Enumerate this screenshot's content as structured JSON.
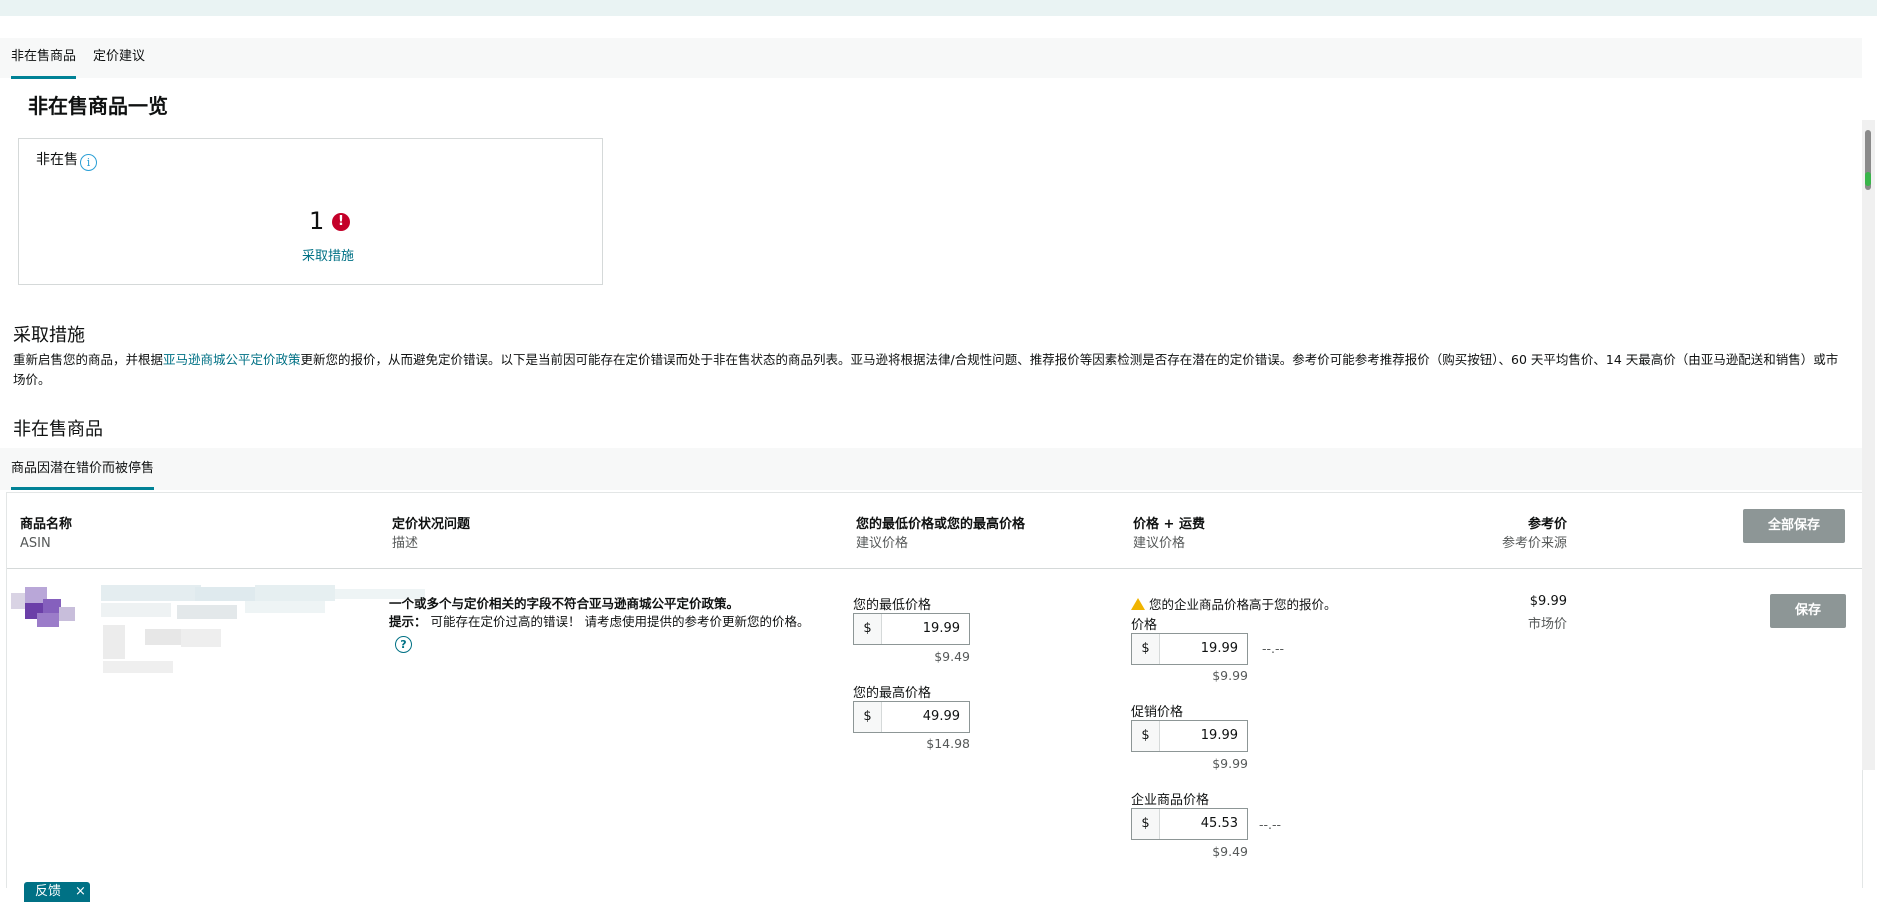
{
  "tabs": [
    {
      "label": "非在售商品",
      "active": true
    },
    {
      "label": "定价建议",
      "active": false
    }
  ],
  "page_title": "非在售商品一览",
  "summary": {
    "label": "非在售",
    "count": "1",
    "link": "采取措施"
  },
  "action": {
    "title": "采取措施",
    "desc_before": "重新启售您的商品，并根据",
    "desc_link": "亚马逊商城公平定价政策",
    "desc_after": "更新您的报价，从而避免定价错误。以下是当前因可能存在定价错误而处于非在售状态的商品列表。亚马逊将根据法律/合规性问题、推荐报价等因素检测是否存在潜在的定价错误。参考价可能参考推荐报价（购买按钮）、60 天平均售价、14 天最高价（由亚马逊配送和销售）或市场价。"
  },
  "inactive_section_title": "非在售商品",
  "subtab": {
    "label": "商品因潜在错价而被停售"
  },
  "table": {
    "headers": {
      "name": "商品名称",
      "name_sub": "ASIN",
      "issue": "定价状况问题",
      "issue_sub": "描述",
      "minmax": "您的最低价格或您的最高价格",
      "minmax_sub": "建议价格",
      "price": "价格 + 运费",
      "price_sub": "建议价格",
      "ref": "参考价",
      "ref_sub": "参考价来源"
    },
    "save_all": "全部保存",
    "row": {
      "issue_title": "一个或多个与定价相关的字段不符合亚马逊商城公平定价政策。",
      "hint_label": "提示：",
      "hint_text": "可能存在定价过高的错误！ 请考虑使用提供的参考价更新您的价格。",
      "min_label": "您的最低价格",
      "min_value": "19.99",
      "min_suggest": "$9.49",
      "max_label": "您的最高价格",
      "max_value": "49.99",
      "max_suggest": "$14.98",
      "warning": "您的企业商品价格高于您的报价。",
      "price_label": "价格",
      "price_value": "19.99",
      "price_suggest": "$9.99",
      "price_ship": "--.--",
      "promo_label": "促销价格",
      "promo_value": "19.99",
      "promo_suggest": "$9.99",
      "biz_label": "企业商品价格",
      "biz_value": "45.53",
      "biz_suggest": "$9.49",
      "biz_ship": "--.--",
      "ref_value": "$9.99",
      "ref_source": "市场价",
      "save": "保存"
    },
    "currency": "$"
  },
  "feedback": {
    "label": "反馈",
    "close": "×"
  },
  "icons": {
    "info": "info-icon",
    "error": "error-icon",
    "help": "help-icon",
    "warning": "warning-icon",
    "close": "close-icon"
  },
  "colors": {
    "accent": "#007185",
    "tab_underline": "#008296",
    "error": "#c40029",
    "button_disabled": "#8d9696",
    "warning": "#f0b400"
  }
}
